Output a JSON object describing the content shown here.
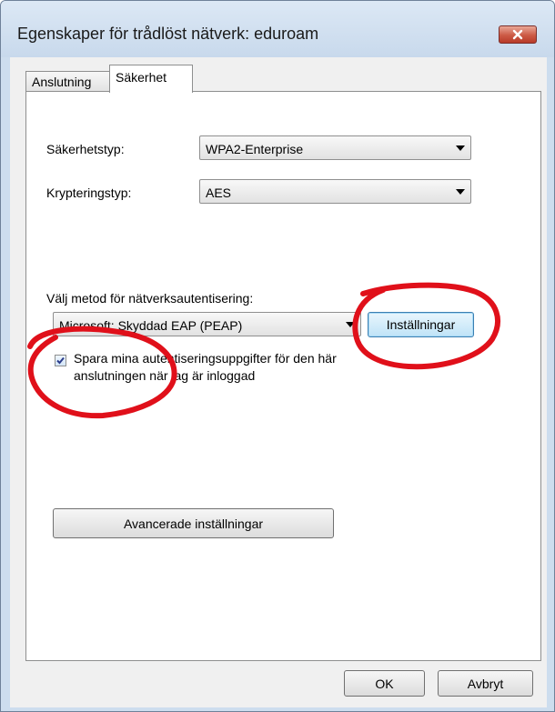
{
  "window": {
    "title": "Egenskaper för trådlöst nätverk: eduroam"
  },
  "tabs": [
    {
      "label": "Anslutning",
      "active": false
    },
    {
      "label": "Säkerhet",
      "active": true
    }
  ],
  "security": {
    "security_type_label": "Säkerhetstyp:",
    "security_type_value": "WPA2-Enterprise",
    "encryption_type_label": "Krypteringstyp:",
    "encryption_type_value": "AES",
    "auth_method_label": "Välj metod för nätverksautentisering:",
    "auth_method_value": "Microsoft: Skyddad EAP (PEAP)",
    "settings_button": "Inställningar",
    "remember_credentials_line1": "Spara mina autentiseringsuppgifter för den här",
    "remember_credentials_line2": "anslutningen när jag är inloggad",
    "remember_credentials_checked": true,
    "advanced_button": "Avancerade inställningar"
  },
  "footer": {
    "ok_button": "OK",
    "cancel_button": "Avbryt"
  },
  "colors": {
    "annotation": "#e0101a",
    "close_button": "#c8503c",
    "focus_border": "#3c7fb1"
  }
}
